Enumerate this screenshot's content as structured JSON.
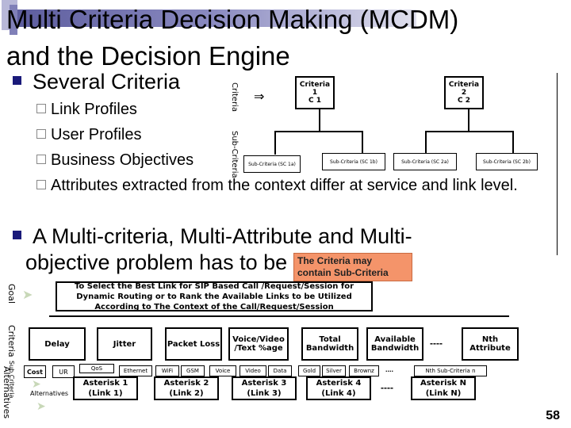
{
  "slide": {
    "title_line1": "Multi Criteria Decision Making (MCDM)",
    "title_line2": "and the Decision Engine",
    "bullet1": "Several Criteria",
    "sub_bullets": [
      "Link Profiles",
      "User Profiles",
      "Business Objectives",
      "Attributes extracted from the context differ at service and link level."
    ],
    "bullet2_line1": "A Multi-criteria, Multi-Attribute and Multi-",
    "bullet2_line2": "objective problem has to be addressed",
    "page_number": "58",
    "callout": "The Criteria may contain Sub-Criteria"
  },
  "criteria_diagram": {
    "row_labels": [
      "Criteria",
      "Sub-Criteria"
    ],
    "criteria": [
      {
        "line1": "Criteria 1",
        "line2": "C 1"
      },
      {
        "line1": "Criteria 2",
        "line2": "C 2"
      }
    ],
    "sub_criteria": [
      "Sub-Criteria (SC 1a)",
      "Sub-Criteria (SC 1b)",
      "Sub-Criteria (SC 2a)",
      "Sub-Criteria (SC 2b)"
    ]
  },
  "hierarchy": {
    "row_labels": [
      "Goal",
      "Criteria",
      "Sub Criteria",
      "Alternatives"
    ],
    "goal": "To Select the Best Link for SIP Based Call /Request/Session for Dynamic Routing or to Rank the Available Links to be Utilized According to The Context of the Call/Request/Session",
    "criteria": [
      "Delay",
      "Jitter",
      "Packet Loss",
      "Voice/Video /Text %age",
      "Total Bandwidth",
      "Available Bandwidth",
      "----",
      "Nth Attribute"
    ],
    "sub_criteria": [
      "Cost",
      "UR",
      "QoS",
      "Ethernet",
      "WiFi",
      "GSM",
      "Voice",
      "Video",
      "Data",
      "Gold",
      "Silver",
      "Brownz",
      "....",
      "Nth Sub-Criteria n"
    ],
    "alternatives_label": "Alternatives",
    "alternatives": [
      {
        "line1": "Asterisk 1",
        "line2": "(Link 1)"
      },
      {
        "line1": "Asterisk 2",
        "line2": "(Link 2)"
      },
      {
        "line1": "Asterisk 3",
        "line2": "(Link 3)"
      },
      {
        "line1": "Asterisk 4",
        "line2": "(Link 4)"
      },
      {
        "line1": "Asterisk N",
        "line2": "(Link N)"
      }
    ],
    "alt_ellipsis": "----"
  }
}
